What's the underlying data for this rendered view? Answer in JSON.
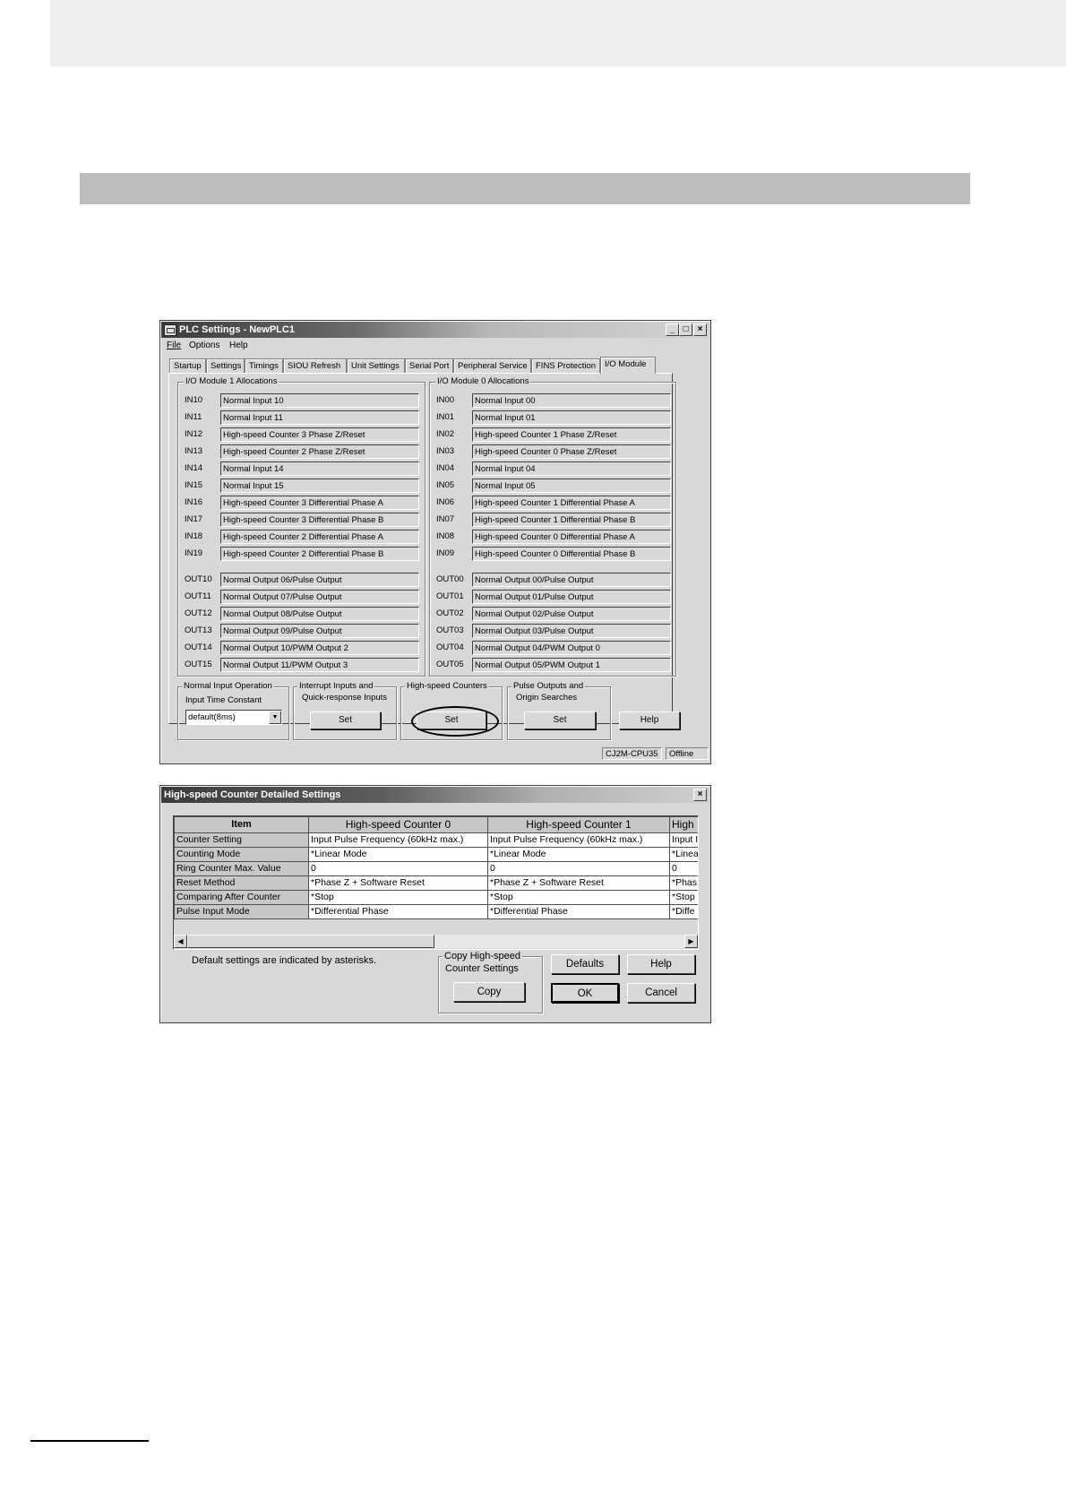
{
  "plc_window": {
    "title": "PLC Settings - NewPLC1",
    "menu": [
      "File",
      "Options",
      "Help"
    ],
    "tabs": [
      "Startup",
      "Settings",
      "Timings",
      "SIOU Refresh",
      "Unit Settings",
      "Serial Port",
      "Peripheral Service",
      "FINS Protection",
      "I/O Module"
    ],
    "active_tab": "I/O Module",
    "module1": {
      "title": "I/O Module 1 Allocations",
      "inputs": [
        {
          "id": "IN10",
          "value": "Normal Input 10"
        },
        {
          "id": "IN11",
          "value": "Normal Input 11"
        },
        {
          "id": "IN12",
          "value": "High-speed Counter 3 Phase Z/Reset"
        },
        {
          "id": "IN13",
          "value": "High-speed Counter 2 Phase Z/Reset"
        },
        {
          "id": "IN14",
          "value": "Normal Input 14"
        },
        {
          "id": "IN15",
          "value": "Normal Input 15"
        },
        {
          "id": "IN16",
          "value": "High-speed Counter 3 Differential Phase A"
        },
        {
          "id": "IN17",
          "value": "High-speed Counter 3 Differential Phase B"
        },
        {
          "id": "IN18",
          "value": "High-speed Counter 2 Differential Phase A"
        },
        {
          "id": "IN19",
          "value": "High-speed Counter 2 Differential Phase B"
        }
      ],
      "outputs": [
        {
          "id": "OUT10",
          "value": "Normal Output 06/Pulse Output"
        },
        {
          "id": "OUT11",
          "value": "Normal Output 07/Pulse Output"
        },
        {
          "id": "OUT12",
          "value": "Normal Output 08/Pulse Output"
        },
        {
          "id": "OUT13",
          "value": "Normal Output 09/Pulse Output"
        },
        {
          "id": "OUT14",
          "value": "Normal Output 10/PWM Output 2"
        },
        {
          "id": "OUT15",
          "value": "Normal Output 11/PWM Output 3"
        }
      ]
    },
    "module0": {
      "title": "I/O Module 0 Allocations",
      "inputs": [
        {
          "id": "IN00",
          "value": "Normal Input 00"
        },
        {
          "id": "IN01",
          "value": "Normal Input 01"
        },
        {
          "id": "IN02",
          "value": "High-speed Counter 1 Phase Z/Reset"
        },
        {
          "id": "IN03",
          "value": "High-speed Counter 0 Phase Z/Reset"
        },
        {
          "id": "IN04",
          "value": "Normal Input 04"
        },
        {
          "id": "IN05",
          "value": "Normal Input 05"
        },
        {
          "id": "IN06",
          "value": "High-speed Counter 1 Differential Phase A"
        },
        {
          "id": "IN07",
          "value": "High-speed Counter 1 Differential Phase B"
        },
        {
          "id": "IN08",
          "value": "High-speed Counter 0 Differential Phase A"
        },
        {
          "id": "IN09",
          "value": "High-speed Counter 0 Differential Phase B"
        }
      ],
      "outputs": [
        {
          "id": "OUT00",
          "value": "Normal Output 00/Pulse Output"
        },
        {
          "id": "OUT01",
          "value": "Normal Output 01/Pulse Output"
        },
        {
          "id": "OUT02",
          "value": "Normal Output 02/Pulse Output"
        },
        {
          "id": "OUT03",
          "value": "Normal Output 03/Pulse Output"
        },
        {
          "id": "OUT04",
          "value": "Normal Output 04/PWM Output 0"
        },
        {
          "id": "OUT05",
          "value": "Normal Output 05/PWM Output 1"
        }
      ]
    },
    "normal_input": {
      "title": "Normal Input Operation",
      "label": "Input Time Constant",
      "selected": "default(8ms)"
    },
    "interrupt": {
      "title_line1": "Interrupt Inputs and",
      "title_line2": "Quick-response Inputs",
      "button": "Set"
    },
    "hsc": {
      "title": "High-speed Counters",
      "button": "Set"
    },
    "pulse": {
      "title_line1": "Pulse Outputs and",
      "title_line2": "Origin Searches",
      "button": "Set"
    },
    "help_button": "Help",
    "status": {
      "model": "CJ2M-CPU35",
      "mode": "Offline"
    }
  },
  "hsc_dialog": {
    "title": "High-speed Counter Detailed Settings",
    "columns": [
      "Item",
      "High-speed Counter 0",
      "High-speed Counter 1",
      "High"
    ],
    "rows": [
      {
        "item": "Counter Setting",
        "c0": "Input Pulse Frequency (60kHz max.)",
        "c1": "Input Pulse Frequency (60kHz max.)",
        "c2": "Input I"
      },
      {
        "item": "Counting Mode",
        "c0": "*Linear Mode",
        "c1": "*Linear Mode",
        "c2": "*Linea"
      },
      {
        "item": "Ring Counter Max. Value",
        "c0": "0",
        "c1": "0",
        "c2": "0"
      },
      {
        "item": "Reset Method",
        "c0": "*Phase Z + Software Reset",
        "c1": "*Phase Z + Software Reset",
        "c2": "*Phas"
      },
      {
        "item": "Comparing After Counter",
        "c0": "*Stop",
        "c1": "*Stop",
        "c2": "*Stop"
      },
      {
        "item": "Pulse Input Mode",
        "c0": "*Differential Phase",
        "c1": "*Differential Phase",
        "c2": "*Diffe"
      }
    ],
    "note": "Default settings are indicated by asterisks.",
    "copy_group": {
      "title_line1": "Copy High-speed",
      "title_line2": "Counter Settings",
      "button": "Copy"
    },
    "buttons": {
      "defaults": "Defaults",
      "help": "Help",
      "ok": "OK",
      "cancel": "Cancel"
    }
  }
}
